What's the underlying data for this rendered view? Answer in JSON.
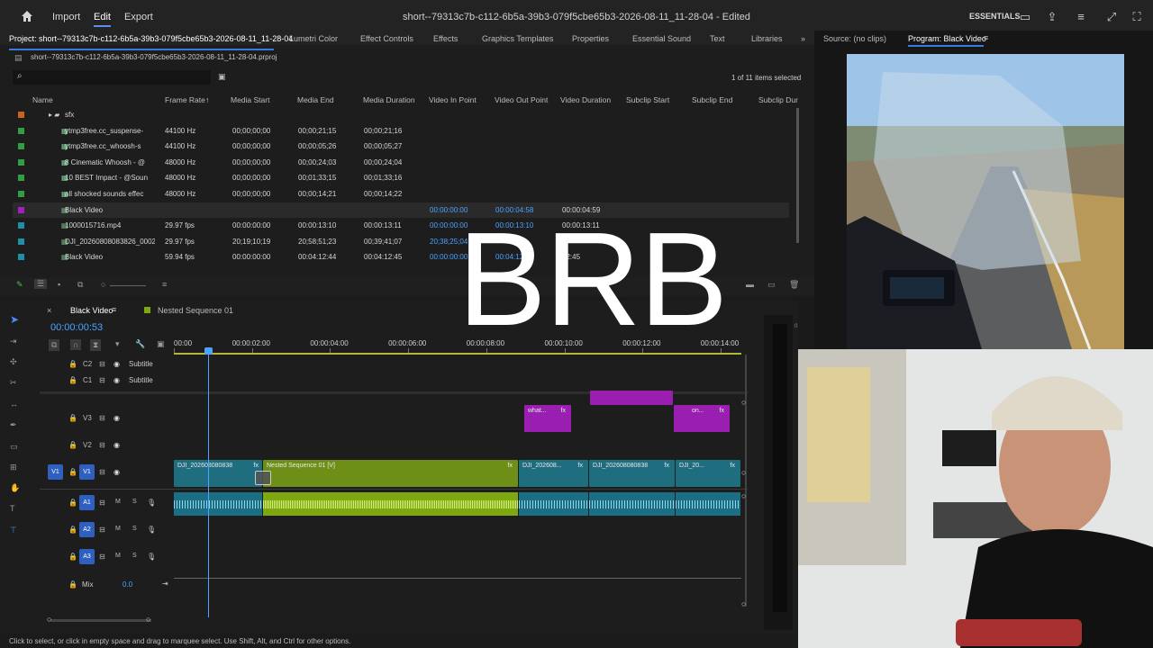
{
  "topbar": {
    "home_label": "",
    "import_label": "Import",
    "edit_label": "Edit",
    "export_label": "Export",
    "doc_title": "short--79313c7b-c112-6b5a-39b3-079f5cbe65b3-2026-08-11_11-28-04 - Edited",
    "workspace_label": "ESSENTIALS"
  },
  "project_panel": {
    "tabs": [
      "Project: short--79313c7b-c112-6b5a-39b3-079f5cbe65b3-2026-08-11_11-28-04",
      "Lumetri Color",
      "Effect Controls",
      "Effects",
      "Graphics Templates",
      "Properties",
      "Essential Sound",
      "Text",
      "Libraries"
    ],
    "file_name": "short--79313c7b-c112-6b5a-39b3-079f5cbe65b3-2026-08-11_11-28-04.prproj",
    "selection_count": "1 of 11 items selected",
    "search_placeholder": "",
    "columns": [
      "Name",
      "Frame Rate",
      "Media Start",
      "Media End",
      "Media Duration",
      "Video In Point",
      "Video Out Point",
      "Video Duration",
      "Subclip Start",
      "Subclip End",
      "Subclip Dur"
    ],
    "rows": [
      {
        "name": "sfx",
        "color": "#c8641e",
        "rate": "",
        "start": "",
        "end": "",
        "dur": "",
        "vin": "",
        "vout": "",
        "vdur": ""
      },
      {
        "name": "ytmp3free.cc_suspense-",
        "color": "#2ea043",
        "rate": "44100 Hz",
        "start": "00;00;00;00",
        "end": "00;00;21;15",
        "dur": "00;00;21;16",
        "vin": "",
        "vout": "",
        "vdur": ""
      },
      {
        "name": "ytmp3free.cc_whoosh-s",
        "color": "#2ea043",
        "rate": "44100 Hz",
        "start": "00;00;00;00",
        "end": "00;00;05;26",
        "dur": "00;00;05;27",
        "vin": "",
        "vout": "",
        "vdur": ""
      },
      {
        "name": "8 Cinematic Whoosh - @",
        "color": "#2ea043",
        "rate": "48000 Hz",
        "start": "00;00;00;00",
        "end": "00;00;24;03",
        "dur": "00;00;24;04",
        "vin": "",
        "vout": "",
        "vdur": ""
      },
      {
        "name": "10 BEST Impact - @Soun",
        "color": "#2ea043",
        "rate": "48000 Hz",
        "start": "00;00;00;00",
        "end": "00;01;33;15",
        "dur": "00;01;33;16",
        "vin": "",
        "vout": "",
        "vdur": ""
      },
      {
        "name": "all shocked sounds effec",
        "color": "#2ea043",
        "rate": "48000 Hz",
        "start": "00;00;00;00",
        "end": "00;00;14;21",
        "dur": "00;00;14;22",
        "vin": "",
        "vout": "",
        "vdur": ""
      },
      {
        "name": "Black Video",
        "color": "#a020c0",
        "rate": "",
        "start": "",
        "end": "",
        "dur": "",
        "vin": "00:00:00:00",
        "vout": "00:00:04:58",
        "vdur": "00:00:04:59"
      },
      {
        "name": "1000015716.mp4",
        "color": "#1e8fa6",
        "rate": "29.97 fps",
        "start": "00:00:00:00",
        "end": "00:00:13:10",
        "dur": "00:00:13:11",
        "vin": "00:00:00:00",
        "vout": "00:00:13:10",
        "vdur": "00:00:13:11"
      },
      {
        "name": "DJI_20260808083826_0002",
        "color": "#1e8fa6",
        "rate": "29.97 fps",
        "start": "20;19;10;19",
        "end": "20;58;51;23",
        "dur": "00;39;41;07",
        "vin": "20;38;25;04",
        "vout": "",
        "vdur": ""
      },
      {
        "name": "Black Video",
        "color": "#1e8fa6",
        "rate": "59.94 fps",
        "start": "00:00:00:00",
        "end": "00:04:12:44",
        "dur": "00:04:12:45",
        "vin": "00:00:00:00",
        "vout": "00:04:12",
        "vdur": "12:45"
      }
    ]
  },
  "source_panel": {
    "source_tab": "Source: (no clips)",
    "program_tab": "Program: Black Video"
  },
  "timeline": {
    "seq_tab": "Black Video",
    "nested_tab": "Nested Sequence 01",
    "timecode": "00:00:00:53",
    "ruler": [
      "00:00",
      "00:00:02:00",
      "00:00:04:00",
      "00:00:06:00",
      "00:00:08:00",
      "00:00:10:00",
      "00:00:12:00",
      "00:00:14:00"
    ],
    "tracks": {
      "c2": "C2",
      "c1": "C1",
      "subtitle": "Subtitle",
      "v3": "V3",
      "v2": "V2",
      "v1": "V1",
      "a1": "A1",
      "a2": "A2",
      "a3": "A3",
      "m": "M",
      "s": "S",
      "mix": "Mix",
      "mix_value": "0.0"
    },
    "clips": {
      "v1_a": "DJI_202608080838",
      "v1_nested": "Nested Sequence 01 [V]",
      "v1_b": "DJI_202608...",
      "v1_c": "DJI_202608080838",
      "v1_d": "DJI_20...",
      "v3_a": "what...",
      "v3_b": "on...",
      "fx": "fx"
    }
  },
  "overlay": {
    "brb": "BRB"
  },
  "status": "Click to select, or click in empty space and drag to marquee select. Use Shift, Alt, and Ctrl for other options.",
  "colors": {
    "accent": "#2f6fd8",
    "teal": "#1f6e80",
    "green": "#7ea80f",
    "purple": "#9a1fb0"
  }
}
